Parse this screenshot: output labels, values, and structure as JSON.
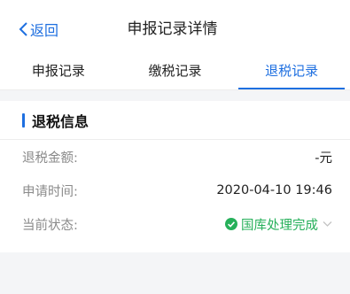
{
  "header": {
    "back_label": "返回",
    "title": "申报记录详情"
  },
  "tabs": [
    {
      "label": "申报记录",
      "active": false
    },
    {
      "label": "缴税记录",
      "active": false
    },
    {
      "label": "退税记录",
      "active": true
    }
  ],
  "section": {
    "title": "退税信息",
    "rows": [
      {
        "label": "退税金额:",
        "value": "-元"
      },
      {
        "label": "申请时间:",
        "value": "2020-04-10 19:46"
      },
      {
        "label": "当前状态:",
        "value": "国库处理完成"
      }
    ]
  },
  "colors": {
    "accent": "#1e6fe0",
    "status_success": "#26b05a",
    "page_bg": "#f4f5f7"
  },
  "icons": {
    "back": "chevron-left-icon",
    "status": "check-circle-icon",
    "expand": "chevron-down-icon"
  }
}
